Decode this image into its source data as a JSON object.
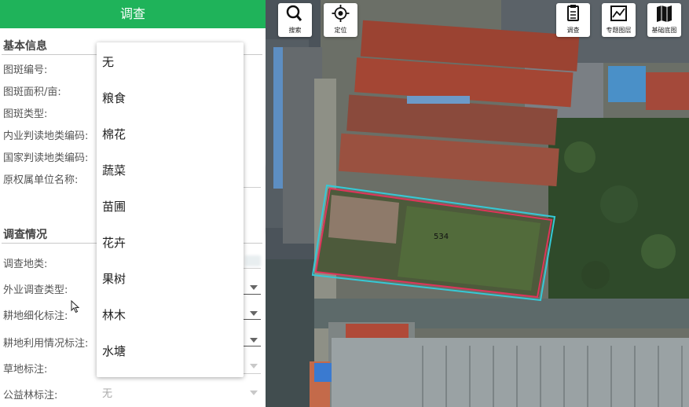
{
  "panel": {
    "header_title": "调查",
    "section_basic": "基本信息",
    "basic_fields": [
      "图斑编号:",
      "图斑面积/亩:",
      "图斑类型:",
      "内业判读地类编码:",
      "国家判读地类编码:",
      "原权属单位名称:"
    ],
    "section_survey": "调查情况",
    "survey_fields": [
      "调查地类:",
      "外业调查类型:",
      "耕地细化标注:",
      "耕地利用情况标注:",
      "草地标注:",
      "公益林标注:"
    ],
    "public_forest_value": "无"
  },
  "dropdown": {
    "options": [
      "无",
      "粮食",
      "棉花",
      "蔬菜",
      "苗圃",
      "花卉",
      "果树",
      "林木",
      "水塘"
    ]
  },
  "map": {
    "parcel_id": "534",
    "toolbar_left": [
      {
        "label": "搜索",
        "icon": "search-icon"
      },
      {
        "label": "定位",
        "icon": "locate-icon"
      }
    ],
    "toolbar_right": [
      {
        "label": "调查",
        "icon": "survey-clipboard-icon"
      },
      {
        "label": "专题图层",
        "icon": "thematic-layer-icon"
      },
      {
        "label": "基础底图",
        "icon": "base-map-icon"
      }
    ],
    "accent_color": "#1fb35a",
    "parcel_outline_colors": [
      "#e0345a",
      "#35c9d6"
    ]
  }
}
